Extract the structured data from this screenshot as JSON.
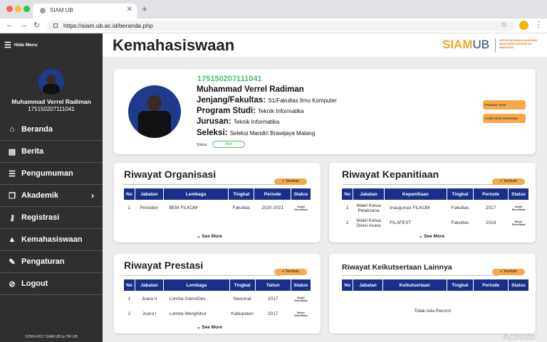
{
  "browser": {
    "tab_title": "SIAM UB",
    "url": "https://siam.ub.ac.id/beranda.php"
  },
  "sidebar": {
    "hide_label": "Hide Menu",
    "user_name": "Muhammad Verrel Radiman",
    "user_nim": "175150207111041",
    "items": [
      {
        "label": "Beranda",
        "icon": "home-icon",
        "glyph": "⌂"
      },
      {
        "label": "Berita",
        "icon": "newspaper-icon",
        "glyph": "▤"
      },
      {
        "label": "Pengumuman",
        "icon": "clipboard-icon",
        "glyph": "☰"
      },
      {
        "label": "Akademik",
        "icon": "document-icon",
        "glyph": "❐"
      },
      {
        "label": "Registrasi",
        "icon": "key-icon",
        "glyph": "⚷"
      },
      {
        "label": "Kemahasiswaan",
        "icon": "graduation-cap-icon",
        "glyph": "▲"
      },
      {
        "label": "Pengaturan",
        "icon": "wrench-icon",
        "glyph": "✎"
      },
      {
        "label": "Logout",
        "icon": "logout-icon",
        "glyph": "⊘"
      }
    ],
    "copyright": "©2004-2017 SIAM UB by TIK UB"
  },
  "header": {
    "title": "Kemahasiswaan",
    "logo_siam": "SIAM",
    "logo_ub": "UB",
    "logo_sub": "SISTEM INFORMASI AKADEMIK MAHASISWA UNIVERSITAS BRAWIJAYA"
  },
  "profile": {
    "nim": "175150207111041",
    "name": "Muhammad Verrel Radiman",
    "fakultas_label": "Jenjang/Fakultas:",
    "fakultas_value": "S1/Fakultas Ilmu Komputer",
    "prodi_label": "Program Studi:",
    "prodi_value": "Teknik Informatika",
    "jurusan_label": "Jurusan:",
    "jurusan_value": "Teknik Informatika",
    "seleksi_label": "Seleksi:",
    "seleksi_value": "Seleksi Mandiri Brawijaya Malang",
    "status_label": "Status:",
    "status_value": "Aktif",
    "btn_panduan": "Panduan SKM",
    "btn_cetak": "Cetak SKM Sementara"
  },
  "organisasi": {
    "title": "Riwayat Organisasi",
    "add": "+ Tambah",
    "headers": [
      "No",
      "Jabatan",
      "Lembaga",
      "Tingkat",
      "Periode",
      "Status"
    ],
    "rows": [
      [
        "1",
        "Presiden",
        "BEM FILKOM",
        "Fakultas",
        "2020-2021",
        "Sudah Diverifikasi"
      ]
    ],
    "more": "See More"
  },
  "kepanitiaan": {
    "title": "Riwayat Kepanitiaan",
    "add": "+ Tambah",
    "headers": [
      "No",
      "Jabatan",
      "Kepanitiaan",
      "Tingkat",
      "Periode",
      "Status"
    ],
    "rows": [
      [
        "1",
        "Wakil Ketua Pelaksana",
        "Inaugurasi FILKOM",
        "Fakultas",
        "2017",
        "Sudah Diverifikasi"
      ],
      [
        "2",
        "Wakil Ketua Divisi Acara",
        "FILAFEST",
        "Fakultas",
        "2018",
        "Belum Diverifikasi"
      ]
    ],
    "more": "See More"
  },
  "prestasi": {
    "title": "Riwayat Prestasi",
    "add": "+ Tambah",
    "headers": [
      "No",
      "Jabatan",
      "Lembaga",
      "Tingkat",
      "Tahun",
      "Status"
    ],
    "rows": [
      [
        "1",
        "Juara II",
        "Lomba GameDev",
        "Nasional",
        "2017",
        "Sudah Diverifikasi"
      ],
      [
        "2",
        "Juara I",
        "Lomba Menghibur",
        "Kabupaten",
        "2017",
        "Belum Diverifikasi"
      ]
    ],
    "more": "See More"
  },
  "lainnya": {
    "title": "Riwayat Keikutsertaan Lainnya",
    "add": "+ Tambah",
    "headers": [
      "No",
      "Jabatan",
      "Keikutsertaan",
      "Tingkat",
      "Periode",
      "Status"
    ],
    "empty": "Tidak Ada Record"
  },
  "watermark": "Activate"
}
